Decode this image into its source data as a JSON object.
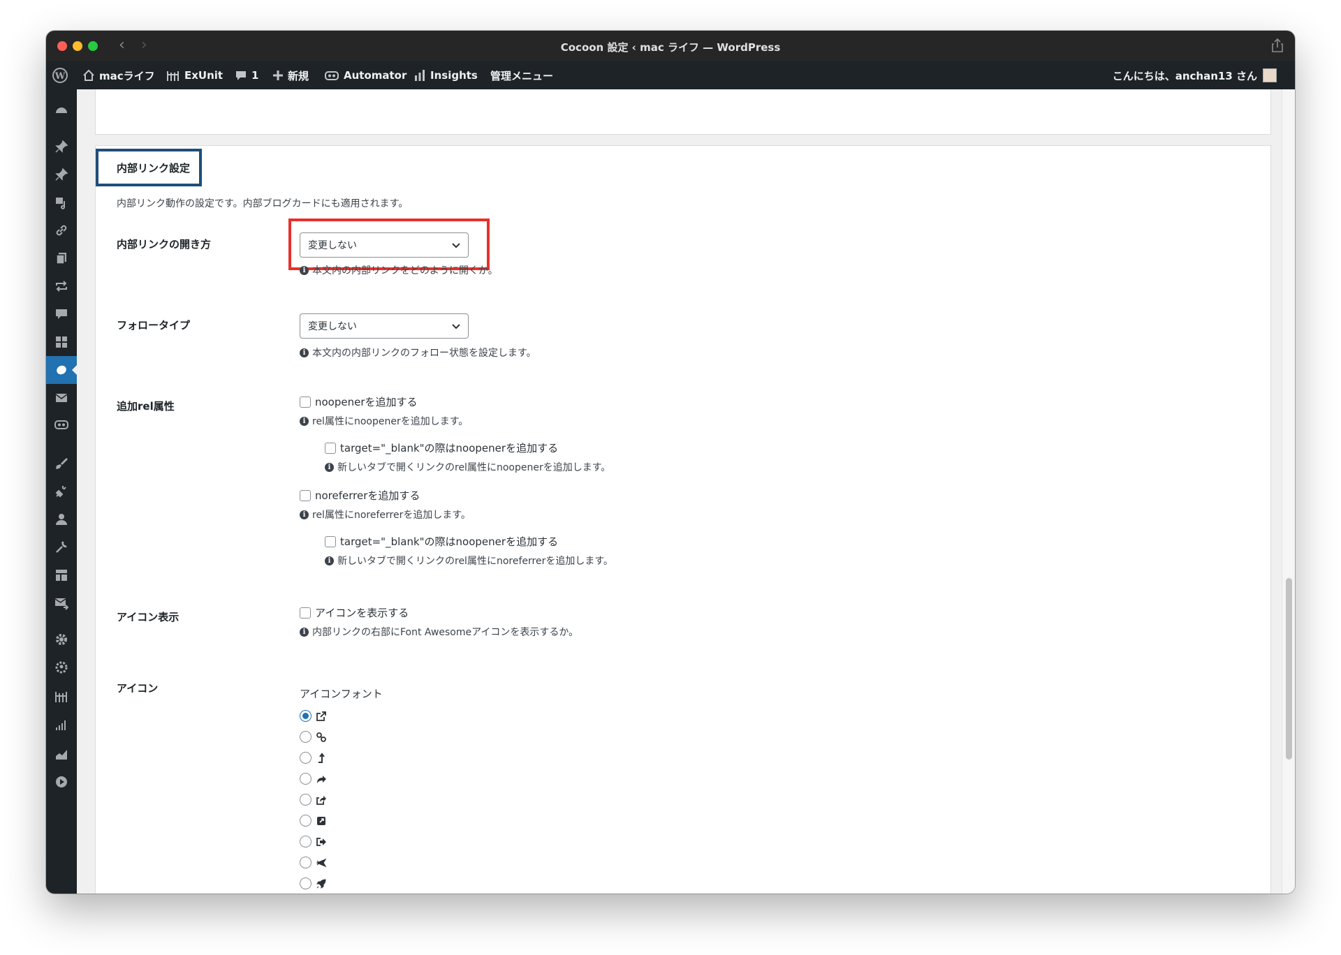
{
  "window": {
    "title": "Cocoon 設定 ‹ mac ライフ — WordPress"
  },
  "adminbar": {
    "items": [
      {
        "label": "macライフ",
        "icon": "home-icon"
      },
      {
        "label": "ExUnit",
        "icon": "exunit-icon"
      },
      {
        "label": "1",
        "icon": "comment-icon"
      },
      {
        "label": "新規",
        "icon": "plus-icon"
      },
      {
        "label": "Automator",
        "icon": "automator-icon"
      },
      {
        "label": "Insights",
        "icon": "insights-icon"
      },
      {
        "label": "管理メニュー",
        "icon": ""
      }
    ],
    "greeting": "こんにちは、anchan13 さん"
  },
  "section": {
    "title": "内部リンク設定",
    "description": "内部リンク動作の設定です。内部ブログカードにも適用されます。"
  },
  "open_method": {
    "label": "内部リンクの開き方",
    "selected": "変更しない",
    "hint": "本文内の内部リンクをどのように開くか。"
  },
  "follow_type": {
    "label": "フォロータイプ",
    "selected": "変更しない",
    "hint": "本文内の内部リンクのフォロー状態を設定します。"
  },
  "rel_attr": {
    "label": "追加rel属性",
    "noopener": {
      "label": "noopenerを追加する",
      "hint": "rel属性にnoopenerを追加します。",
      "checked": false
    },
    "noopener_blank": {
      "label": "target=\"_blank\"の際はnoopenerを追加する",
      "hint": "新しいタブで開くリンクのrel属性にnoopenerを追加します。",
      "checked": false
    },
    "noreferrer": {
      "label": "noreferrerを追加する",
      "hint": "rel属性にnoreferrerを追加します。",
      "checked": false
    },
    "noreferrer_blank": {
      "label": "target=\"_blank\"の際はnoopenerを追加する",
      "hint": "新しいタブで開くリンクのrel属性にnoreferrerを追加します。",
      "checked": false
    }
  },
  "icon_display": {
    "label": "アイコン表示",
    "checkbox_label": "アイコンを表示する",
    "checked": false,
    "hint": "内部リンクの右部にFont Awesomeアイコンを表示するか。"
  },
  "icon": {
    "label": "アイコン",
    "font_label": "アイコンフォント",
    "options": [
      {
        "icon": "external-link-icon",
        "checked": true
      },
      {
        "icon": "chain-link-icon",
        "checked": false
      },
      {
        "icon": "level-up-icon",
        "checked": false
      },
      {
        "icon": "share-arrow-icon",
        "checked": false
      },
      {
        "icon": "share-square-icon",
        "checked": false
      },
      {
        "icon": "external-square-icon",
        "checked": false
      },
      {
        "icon": "sign-out-icon",
        "checked": false
      },
      {
        "icon": "plane-icon",
        "checked": false
      },
      {
        "icon": "rocket-icon",
        "checked": false
      }
    ]
  },
  "colors": {
    "accent": "#2271b1",
    "highlight_red": "#e8302a",
    "title_border": "#1f4e7a",
    "admin_bg": "#1d2327"
  }
}
